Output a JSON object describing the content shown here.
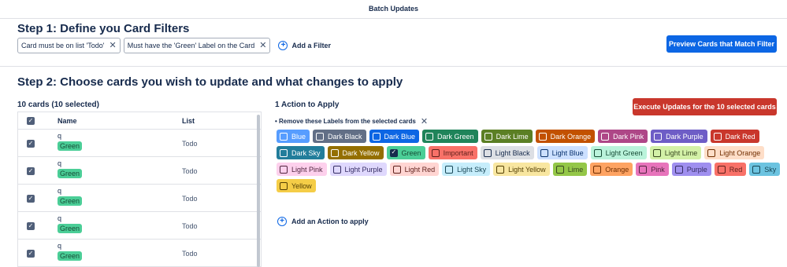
{
  "window": {
    "title": "Batch Updates"
  },
  "step1": {
    "heading": "Step 1: Define you Card Filters",
    "filters": [
      {
        "label": "Card must be on list 'Todo'"
      },
      {
        "label": "Must have the 'Green' Label on the Card"
      }
    ],
    "add_filter_label": "Add a Filter",
    "preview_button": "Preview Cards that Match Filter"
  },
  "step2": {
    "heading": "Step 2: Choose cards you wish to update and what changes to apply",
    "cards_title": "10 cards (10 selected)",
    "columns": {
      "name": "Name",
      "list": "List"
    },
    "rows": [
      {
        "name": "q",
        "label": "Green",
        "list": "Todo",
        "checked": true
      },
      {
        "name": "q",
        "label": "Green",
        "list": "Todo",
        "checked": true
      },
      {
        "name": "q",
        "label": "Green",
        "list": "Todo",
        "checked": true
      },
      {
        "name": "q",
        "label": "Green",
        "list": "Todo",
        "checked": true
      },
      {
        "name": "q",
        "label": "Green",
        "list": "Todo",
        "checked": true
      }
    ],
    "actions_title": "1 Action to Apply",
    "execute_button": "Execute Updates for the 10 selected cards",
    "action_description": "• Remove these Labels from the selected cards",
    "add_action_label": "Add an Action to apply",
    "labels": [
      {
        "name": "Blue",
        "bg": "#579dff",
        "fg": "#ffffff",
        "checked": false
      },
      {
        "name": "Dark Black",
        "bg": "#626f86",
        "fg": "#ffffff",
        "checked": false
      },
      {
        "name": "Dark Blue",
        "bg": "#0c66e4",
        "fg": "#ffffff",
        "checked": false
      },
      {
        "name": "Dark Green",
        "bg": "#1f845a",
        "fg": "#ffffff",
        "checked": false
      },
      {
        "name": "Dark Lime",
        "bg": "#5b7f24",
        "fg": "#ffffff",
        "checked": false
      },
      {
        "name": "Dark Orange",
        "bg": "#c25100",
        "fg": "#ffffff",
        "checked": false
      },
      {
        "name": "Dark Pink",
        "bg": "#ae4787",
        "fg": "#ffffff",
        "checked": false
      },
      {
        "name": "Dark Purple",
        "bg": "#6e5dc6",
        "fg": "#ffffff",
        "checked": false
      },
      {
        "name": "Dark Red",
        "bg": "#c9372c",
        "fg": "#ffffff",
        "checked": false
      },
      {
        "name": "Dark Sky",
        "bg": "#227d9b",
        "fg": "#ffffff",
        "checked": false
      },
      {
        "name": "Dark Yellow",
        "bg": "#946f00",
        "fg": "#ffffff",
        "checked": false
      },
      {
        "name": "Green",
        "bg": "#4bce97",
        "fg": "#164b35",
        "checked": true
      },
      {
        "name": "Important",
        "bg": "#f87168",
        "fg": "#5d1f1a",
        "checked": false
      },
      {
        "name": "Light Black",
        "bg": "#dcdfe4",
        "fg": "#172b4d",
        "checked": false
      },
      {
        "name": "Light Blue",
        "bg": "#cce0ff",
        "fg": "#09326c",
        "checked": false
      },
      {
        "name": "Light Green",
        "bg": "#baf3db",
        "fg": "#164b35",
        "checked": false
      },
      {
        "name": "Light Lime",
        "bg": "#d3f1a7",
        "fg": "#37471f",
        "checked": false
      },
      {
        "name": "Light Orange",
        "bg": "#fedec8",
        "fg": "#702e00",
        "checked": false
      },
      {
        "name": "Light Pink",
        "bg": "#fdd0ec",
        "fg": "#50253f",
        "checked": false
      },
      {
        "name": "Light Purple",
        "bg": "#dfd8fd",
        "fg": "#352c63",
        "checked": false
      },
      {
        "name": "Light Red",
        "bg": "#ffd5d2",
        "fg": "#5d1f1a",
        "checked": false
      },
      {
        "name": "Light Sky",
        "bg": "#c6edfb",
        "fg": "#164555",
        "checked": false
      },
      {
        "name": "Light Yellow",
        "bg": "#f8e6a0",
        "fg": "#533f04",
        "checked": false
      },
      {
        "name": "Lime",
        "bg": "#94c748",
        "fg": "#37471f",
        "checked": false
      },
      {
        "name": "Orange",
        "bg": "#fea362",
        "fg": "#702e00",
        "checked": false
      },
      {
        "name": "Pink",
        "bg": "#e774bb",
        "fg": "#50253f",
        "checked": false
      },
      {
        "name": "Purple",
        "bg": "#9f8fef",
        "fg": "#352c63",
        "checked": false
      },
      {
        "name": "Red",
        "bg": "#f87168",
        "fg": "#5d1f1a",
        "checked": false
      },
      {
        "name": "Sky",
        "bg": "#6cc3e0",
        "fg": "#164555",
        "checked": false
      },
      {
        "name": "Yellow",
        "bg": "#f5cd47",
        "fg": "#533f04",
        "checked": false
      }
    ]
  },
  "icons": {
    "close": "close-icon",
    "add": "plus-circle-icon",
    "checkbox": "checkbox-icon"
  }
}
